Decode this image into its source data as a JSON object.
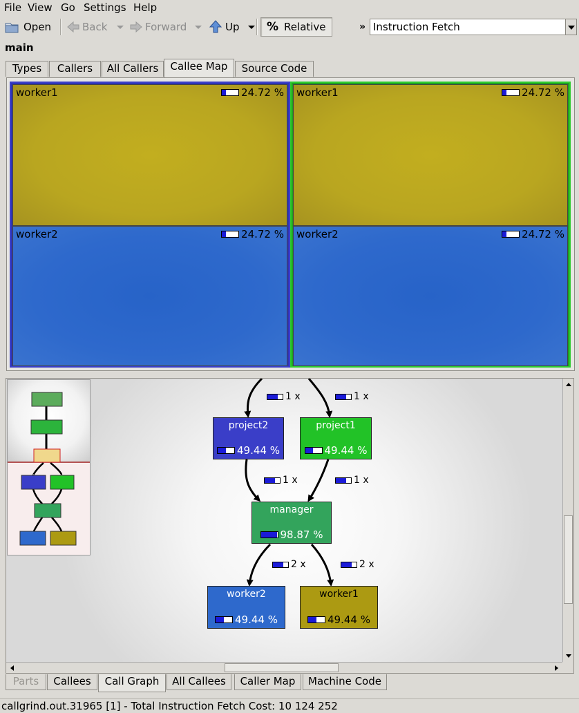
{
  "menubar": [
    "File",
    "View",
    "Go",
    "Settings",
    "Help"
  ],
  "toolbar": {
    "open": "Open",
    "back": "Back",
    "forward": "Forward",
    "up": "Up",
    "relative": "Relative",
    "relative_icon": "%",
    "overflow": "»",
    "event_type": "Instruction Fetch"
  },
  "function_name": "main",
  "top_tabs": [
    "Types",
    "Callers",
    "All Callers",
    "Callee Map",
    "Source Code"
  ],
  "top_tabs_active": "Callee Map",
  "callee_map": [
    {
      "name": "worker1",
      "pct": "24.72 %",
      "fraction": 0.2472
    },
    {
      "name": "worker2",
      "pct": "24.72 %",
      "fraction": 0.2472
    },
    {
      "name": "worker1",
      "pct": "24.72 %",
      "fraction": 0.2472
    },
    {
      "name": "worker2",
      "pct": "24.72 %",
      "fraction": 0.2472
    }
  ],
  "call_graph": {
    "nodes": {
      "project2": {
        "name": "project2",
        "pct": "49.44 %",
        "fraction": 0.4944,
        "color": "#3a3ec8"
      },
      "project1": {
        "name": "project1",
        "pct": "49.44 %",
        "fraction": 0.4944,
        "color": "#22c227"
      },
      "manager": {
        "name": "manager",
        "pct": "98.87 %",
        "fraction": 0.9887,
        "color": "#33a45c"
      },
      "worker2": {
        "name": "worker2",
        "pct": "49.44 %",
        "fraction": 0.4944,
        "color": "#2e69cc"
      },
      "worker1": {
        "name": "worker1",
        "pct": "49.44 %",
        "fraction": 0.4944,
        "color": "#ac9a12"
      }
    },
    "edge_labels": {
      "in_project2": "1 x",
      "in_project1": "1 x",
      "project2_manager": "1 x",
      "project1_manager": "1 x",
      "manager_worker2": "2 x",
      "manager_worker1": "2 x"
    }
  },
  "bottom_tabs": [
    "Parts",
    "Callees",
    "Call Graph",
    "All Callees",
    "Caller Map",
    "Machine Code"
  ],
  "bottom_tabs_active": "Call Graph",
  "status": "callgrind.out.31965 [1] - Total Instruction Fetch Cost: 10 124 252"
}
